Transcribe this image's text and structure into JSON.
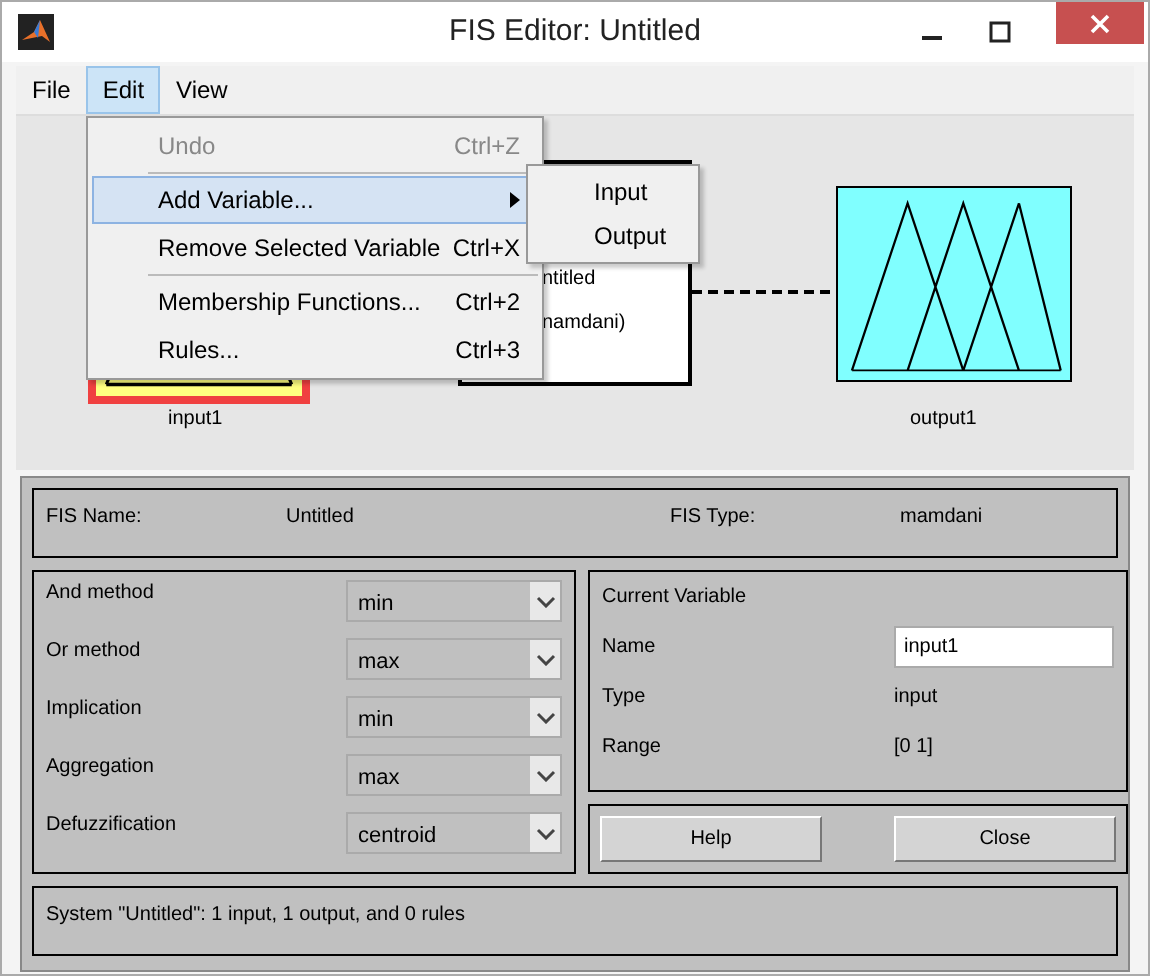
{
  "window": {
    "title": "FIS Editor: Untitled"
  },
  "menu_bar": [
    {
      "label": "File",
      "selected": false
    },
    {
      "label": "Edit",
      "selected": true
    },
    {
      "label": "View",
      "selected": false
    }
  ],
  "edit_menu": [
    {
      "kind": "item",
      "label": "Undo",
      "shortcut": "Ctrl+Z",
      "disabled": true,
      "selected": false
    },
    {
      "kind": "separator"
    },
    {
      "kind": "item",
      "label": "Add Variable...",
      "disabled": false,
      "selected": true,
      "submenu": true
    },
    {
      "kind": "item",
      "label": "Remove Selected Variable",
      "shortcut": "Ctrl+X",
      "disabled": false,
      "selected": false
    },
    {
      "kind": "separator"
    },
    {
      "kind": "item",
      "label": "Membership Functions...",
      "shortcut": "Ctrl+2",
      "disabled": false,
      "selected": false
    },
    {
      "kind": "item",
      "label": "Rules...",
      "shortcut": "Ctrl+3",
      "disabled": false,
      "selected": false
    }
  ],
  "submenu": [
    "Input",
    "Output"
  ],
  "diagram": {
    "input": {
      "label": "input1",
      "selected": true
    },
    "system_lines": [
      "ntitled",
      "namdani)"
    ],
    "output": {
      "label": "output1",
      "selected": false
    }
  },
  "fis": {
    "name_label": "FIS Name:",
    "name": "Untitled",
    "type_label": "FIS Type:",
    "type": "mamdani"
  },
  "methods": [
    {
      "label": "And method",
      "value": "min"
    },
    {
      "label": "Or method",
      "value": "max"
    },
    {
      "label": "Implication",
      "value": "min"
    },
    {
      "label": "Aggregation",
      "value": "max"
    },
    {
      "label": "Defuzzification",
      "value": "centroid"
    }
  ],
  "current_variable": {
    "title": "Current Variable",
    "fields": [
      {
        "kind": "input",
        "label": "Name",
        "value": "input1"
      },
      {
        "kind": "text",
        "label": "Type",
        "value": "input"
      },
      {
        "kind": "text",
        "label": "Range",
        "value": "[0 1]"
      }
    ]
  },
  "buttons": [
    "Help",
    "Close"
  ],
  "status": "System \"Untitled\": 1 input, 1 output, and 0 rules"
}
